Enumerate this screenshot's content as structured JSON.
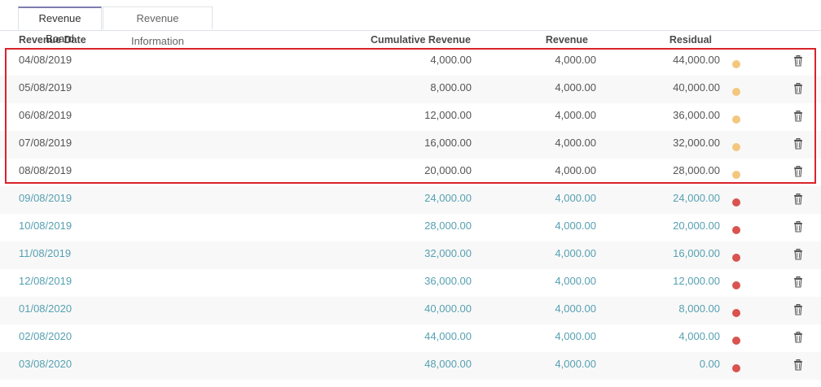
{
  "tabs": [
    {
      "label": "Revenue Board",
      "active": true
    },
    {
      "label": "Revenue Information",
      "active": false
    }
  ],
  "columns": {
    "date": "Revenue Date",
    "cumulative": "Cumulative Revenue",
    "revenue": "Revenue",
    "residual": "Residual"
  },
  "colors": {
    "posted_dot": "#f3c77e",
    "draft_dot": "#d9534f",
    "draft_text": "#56a0b2",
    "highlight": "#d9232a"
  },
  "rows": [
    {
      "date": "04/08/2019",
      "cumulative": "4,000.00",
      "revenue": "4,000.00",
      "residual": "44,000.00",
      "state": "posted"
    },
    {
      "date": "05/08/2019",
      "cumulative": "8,000.00",
      "revenue": "4,000.00",
      "residual": "40,000.00",
      "state": "posted"
    },
    {
      "date": "06/08/2019",
      "cumulative": "12,000.00",
      "revenue": "4,000.00",
      "residual": "36,000.00",
      "state": "posted"
    },
    {
      "date": "07/08/2019",
      "cumulative": "16,000.00",
      "revenue": "4,000.00",
      "residual": "32,000.00",
      "state": "posted"
    },
    {
      "date": "08/08/2019",
      "cumulative": "20,000.00",
      "revenue": "4,000.00",
      "residual": "28,000.00",
      "state": "posted"
    },
    {
      "date": "09/08/2019",
      "cumulative": "24,000.00",
      "revenue": "4,000.00",
      "residual": "24,000.00",
      "state": "draft"
    },
    {
      "date": "10/08/2019",
      "cumulative": "28,000.00",
      "revenue": "4,000.00",
      "residual": "20,000.00",
      "state": "draft"
    },
    {
      "date": "11/08/2019",
      "cumulative": "32,000.00",
      "revenue": "4,000.00",
      "residual": "16,000.00",
      "state": "draft"
    },
    {
      "date": "12/08/2019",
      "cumulative": "36,000.00",
      "revenue": "4,000.00",
      "residual": "12,000.00",
      "state": "draft"
    },
    {
      "date": "01/08/2020",
      "cumulative": "40,000.00",
      "revenue": "4,000.00",
      "residual": "8,000.00",
      "state": "draft"
    },
    {
      "date": "02/08/2020",
      "cumulative": "44,000.00",
      "revenue": "4,000.00",
      "residual": "4,000.00",
      "state": "draft"
    },
    {
      "date": "03/08/2020",
      "cumulative": "48,000.00",
      "revenue": "4,000.00",
      "residual": "0.00",
      "state": "draft"
    }
  ]
}
